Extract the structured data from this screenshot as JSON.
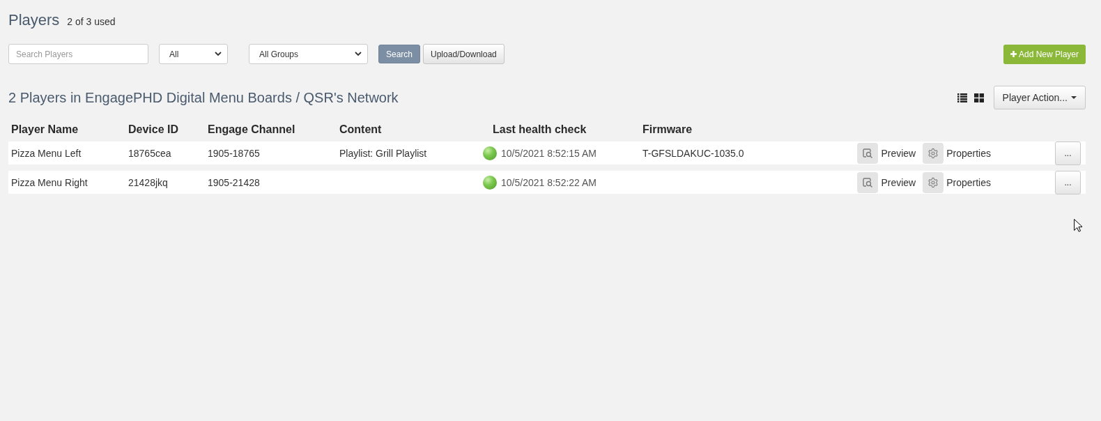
{
  "header": {
    "title": "Players",
    "usage": "2 of 3 used"
  },
  "filters": {
    "search": {
      "placeholder": "Search Players"
    },
    "status_select": {
      "value": "All"
    },
    "group_select": {
      "value": "All Groups"
    },
    "buttons": [
      {
        "label": "Search",
        "kind": "primary"
      },
      {
        "label": "Upload/Download",
        "kind": "default"
      }
    ],
    "add_button": {
      "label": "Add New Player"
    }
  },
  "network": {
    "heading": "2 Players in EngagePHD Digital Menu Boards / QSR's Network",
    "action_menu": {
      "label": "Player Action..."
    }
  },
  "table": {
    "columns": [
      "Player Name",
      "Device ID",
      "Engage Channel",
      "Content",
      "Last health check",
      "Firmware"
    ],
    "rows": [
      {
        "player_name": "Pizza Menu Left",
        "device_id": "18765cea",
        "engage_channel": "1905-18765",
        "content": "Playlist: Grill Playlist",
        "healthy": true,
        "last_health_check": "10/5/2021 8:52:15 AM",
        "firmware": "T-GFSLDAKUC-1035.0",
        "actions": [
          {
            "kind": "preview",
            "label": "Preview"
          },
          {
            "kind": "properties",
            "label": "Properties"
          }
        ],
        "more": "..."
      },
      {
        "player_name": "Pizza Menu Right",
        "device_id": "21428jkq",
        "engage_channel": "1905-21428",
        "healthy": true,
        "last_health_check": "10/5/2021 8:52:22 AM",
        "actions": [
          {
            "kind": "preview",
            "label": "Preview"
          },
          {
            "kind": "properties",
            "label": "Properties"
          }
        ],
        "more": "..."
      }
    ]
  }
}
